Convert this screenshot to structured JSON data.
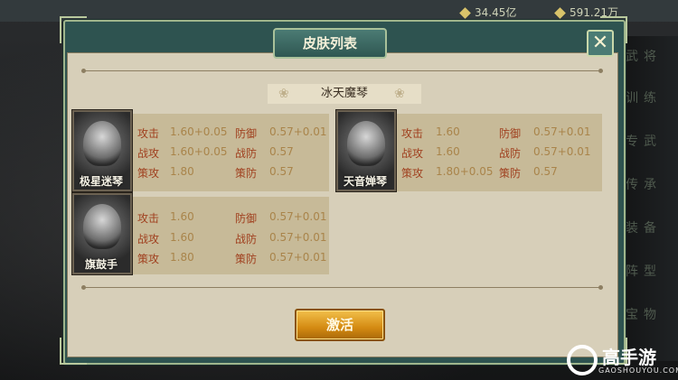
{
  "topbar": {
    "resource1": "34.45亿",
    "resource2": "591.21万"
  },
  "side_tabs": [
    "武将",
    "训练",
    "专武",
    "传承",
    "装备",
    "阵型",
    "宝物"
  ],
  "dialog": {
    "title": "皮肤列表",
    "close_icon": "close-icon",
    "group_title": "冰天魔琴",
    "activate_label": "激活"
  },
  "skins": [
    {
      "name": "极星迷琴",
      "stats": [
        {
          "label": "攻击",
          "value": "1.60+0.05"
        },
        {
          "label": "防御",
          "value": "0.57+0.01"
        },
        {
          "label": "战攻",
          "value": "1.60+0.05"
        },
        {
          "label": "战防",
          "value": "0.57"
        },
        {
          "label": "策攻",
          "value": "1.80"
        },
        {
          "label": "策防",
          "value": "0.57"
        }
      ]
    },
    {
      "name": "天音婵琴",
      "stats": [
        {
          "label": "攻击",
          "value": "1.60"
        },
        {
          "label": "防御",
          "value": "0.57+0.01"
        },
        {
          "label": "战攻",
          "value": "1.60"
        },
        {
          "label": "战防",
          "value": "0.57+0.01"
        },
        {
          "label": "策攻",
          "value": "1.80+0.05"
        },
        {
          "label": "策防",
          "value": "0.57"
        }
      ]
    },
    {
      "name": "旗鼓手",
      "stats": [
        {
          "label": "攻击",
          "value": "1.60"
        },
        {
          "label": "防御",
          "value": "0.57+0.01"
        },
        {
          "label": "战攻",
          "value": "1.60"
        },
        {
          "label": "战防",
          "value": "0.57+0.01"
        },
        {
          "label": "策攻",
          "value": "1.80"
        },
        {
          "label": "策防",
          "value": "0.57+0.01"
        }
      ]
    }
  ],
  "watermark": {
    "brand": "高手游",
    "url": "GAOSHOUYOU.COM"
  },
  "colors": {
    "panel_frame": "#2e5350",
    "parchment": "#d7cfb9",
    "card": "#c7ba98",
    "stat_label": "#a0401f",
    "stat_value": "#a9844a",
    "button": "#d48a12"
  }
}
